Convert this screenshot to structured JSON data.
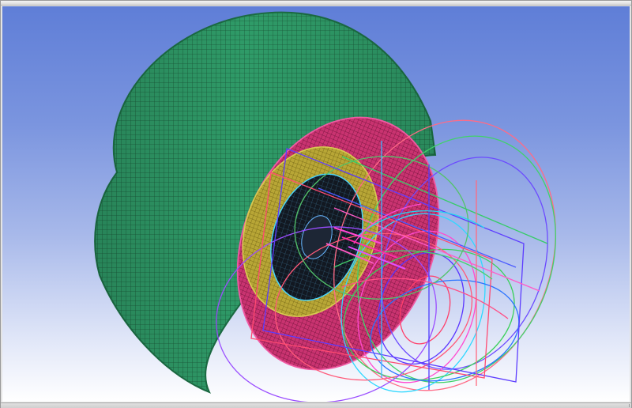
{
  "window": {
    "title": ""
  },
  "viewport": {
    "content": "3d-mesh-wireframe",
    "background_top": "#5f7ed7",
    "background_bottom": "#ffffff"
  },
  "colors": {
    "outer_shell": "#2f9b68",
    "outer_shell_edge": "#1b6a42",
    "pink_mesh": "#d8327d",
    "yellow_band": "#c7b23b",
    "dark_core": "#1a2130",
    "wire_blue": "#5b3cff",
    "wire_green": "#29c766",
    "wire_red": "#ff3a55",
    "wire_cyan": "#18d8e8",
    "wire_magenta": "#ff47d4"
  }
}
